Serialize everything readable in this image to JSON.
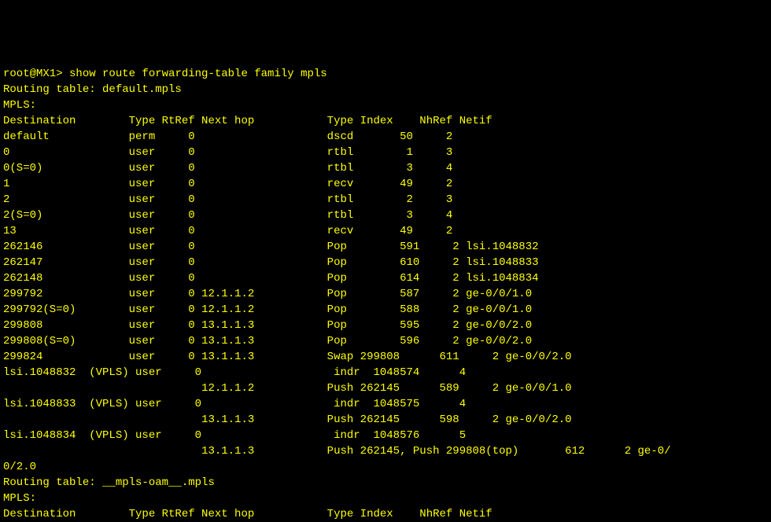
{
  "prompt": "root@MX1> ",
  "command": "show route forwarding-table family mpls",
  "section1": {
    "routing_table": "Routing table: default.mpls",
    "proto": "MPLS:",
    "header": "Destination        Type RtRef Next hop           Type Index    NhRef Netif",
    "rows": [
      "default            perm     0                    dscd       50     2",
      "0                  user     0                    rtbl        1     3",
      "0(S=0)             user     0                    rtbl        3     4",
      "1                  user     0                    recv       49     2",
      "2                  user     0                    rtbl        2     3",
      "2(S=0)             user     0                    rtbl        3     4",
      "13                 user     0                    recv       49     2",
      "262146             user     0                    Pop        591     2 lsi.1048832",
      "262147             user     0                    Pop        610     2 lsi.1048833",
      "262148             user     0                    Pop        614     2 lsi.1048834",
      "299792             user     0 12.1.1.2           Pop        587     2 ge-0/0/1.0",
      "299792(S=0)        user     0 12.1.1.2           Pop        588     2 ge-0/0/1.0",
      "299808             user     0 13.1.1.3           Pop        595     2 ge-0/0/2.0",
      "299808(S=0)        user     0 13.1.1.3           Pop        596     2 ge-0/0/2.0",
      "299824             user     0 13.1.1.3           Swap 299808      611     2 ge-0/0/2.0",
      "lsi.1048832  (VPLS) user     0                    indr  1048574      4",
      "                              12.1.1.2           Push 262145      589     2 ge-0/0/1.0",
      "lsi.1048833  (VPLS) user     0                    indr  1048575      4",
      "                              13.1.1.3           Push 262145      598     2 ge-0/0/2.0",
      "lsi.1048834  (VPLS) user     0                    indr  1048576      5",
      "                              13.1.1.3           Push 262145, Push 299808(top)       612      2 ge-0/",
      "0/2.0"
    ]
  },
  "section2": {
    "routing_table": "Routing table: __mpls-oam__.mpls",
    "proto": "MPLS:",
    "header": "Destination        Type RtRef Next hop           Type Index    NhRef Netif"
  }
}
